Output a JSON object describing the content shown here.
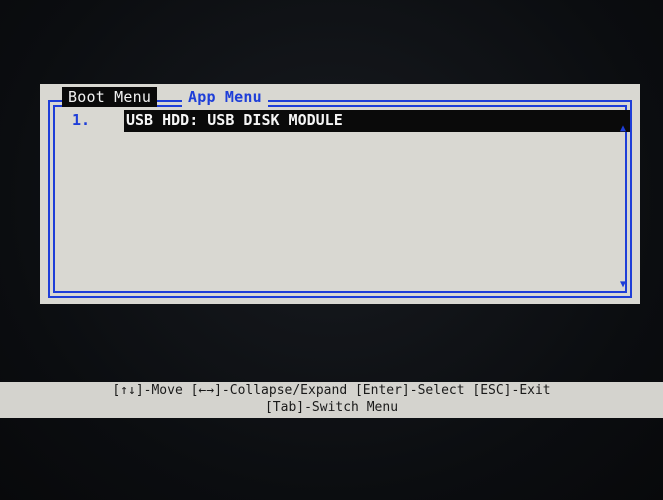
{
  "tabs": {
    "boot_menu": "Boot Menu",
    "app_menu": "App Menu"
  },
  "boot_list": {
    "items": [
      {
        "index": "1.",
        "label": "USB HDD: USB DISK MODULE"
      }
    ]
  },
  "scroll": {
    "up_icon": "triangle-up",
    "down_icon": "triangle-down"
  },
  "help": {
    "line1": "[↑↓]-Move [←→]-Collapse/Expand [Enter]-Select [ESC]-Exit",
    "line2": "[Tab]-Switch Menu"
  },
  "colors": {
    "accent": "#1e3ed8",
    "panel_bg": "#d9d8d2",
    "highlight_bg": "#0a0a0a"
  }
}
